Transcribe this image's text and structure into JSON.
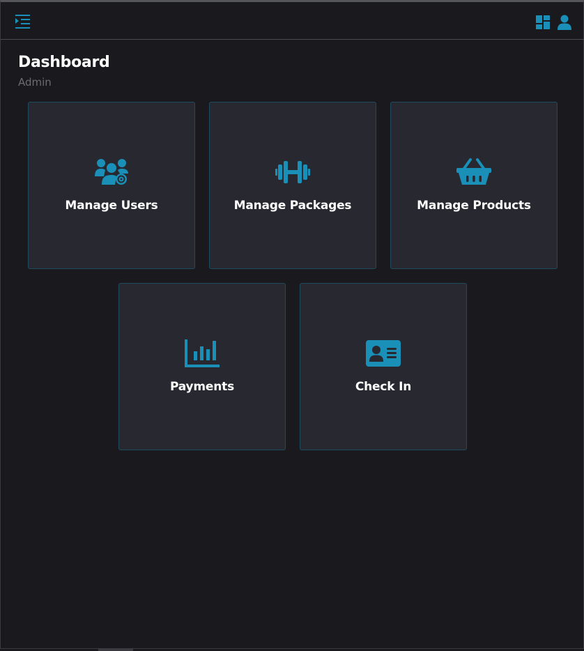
{
  "header": {
    "menu_icon": "menu-toggle-icon",
    "dashboard_icon": "dashboard-layout-icon",
    "user_icon": "user-icon"
  },
  "page": {
    "title": "Dashboard",
    "subtitle": "Admin"
  },
  "cards": [
    {
      "label": "Manage Users",
      "icon": "users-gear-icon"
    },
    {
      "label": "Manage Packages",
      "icon": "dumbbell-icon"
    },
    {
      "label": "Manage Products",
      "icon": "basket-icon"
    },
    {
      "label": "Payments",
      "icon": "bar-chart-icon"
    },
    {
      "label": "Check In",
      "icon": "id-card-icon"
    }
  ],
  "colors": {
    "accent": "#1a8fb8",
    "background": "#1a1a1e",
    "card": "#272830",
    "card_border": "#1f4a5e"
  }
}
